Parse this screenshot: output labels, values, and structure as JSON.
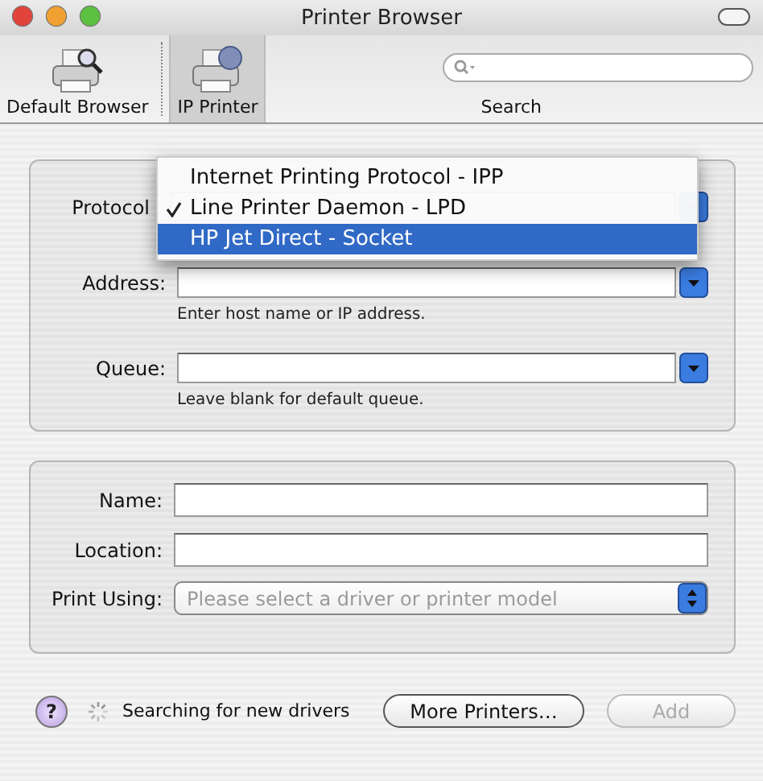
{
  "window": {
    "title": "Printer Browser"
  },
  "toolbar": {
    "items": [
      {
        "label": "Default Browser",
        "selected": false,
        "kind": "browser"
      },
      {
        "label": "IP Printer",
        "selected": true,
        "kind": "ip"
      }
    ],
    "search": {
      "label": "Search"
    }
  },
  "connection": {
    "protocol": {
      "label": "Protocol",
      "menu": [
        {
          "label": "Internet Printing Protocol - IPP",
          "checked": false,
          "selected": false
        },
        {
          "label": "Line Printer Daemon - LPD",
          "checked": true,
          "selected": false
        },
        {
          "label": "HP Jet Direct - Socket",
          "checked": false,
          "selected": true
        }
      ]
    },
    "address": {
      "label": "Address:",
      "hint": "Enter host name or IP address."
    },
    "queue": {
      "label": "Queue:",
      "hint": "Leave blank for default queue."
    }
  },
  "details": {
    "name": {
      "label": "Name:"
    },
    "location": {
      "label": "Location:"
    },
    "print_using": {
      "label": "Print Using:",
      "placeholder": "Please select a driver or printer model"
    }
  },
  "footer": {
    "help": "?",
    "status": "Searching for new drivers",
    "buttons": [
      {
        "label": "More Printers…",
        "disabled": false
      },
      {
        "label": "Add",
        "disabled": true
      }
    ]
  }
}
